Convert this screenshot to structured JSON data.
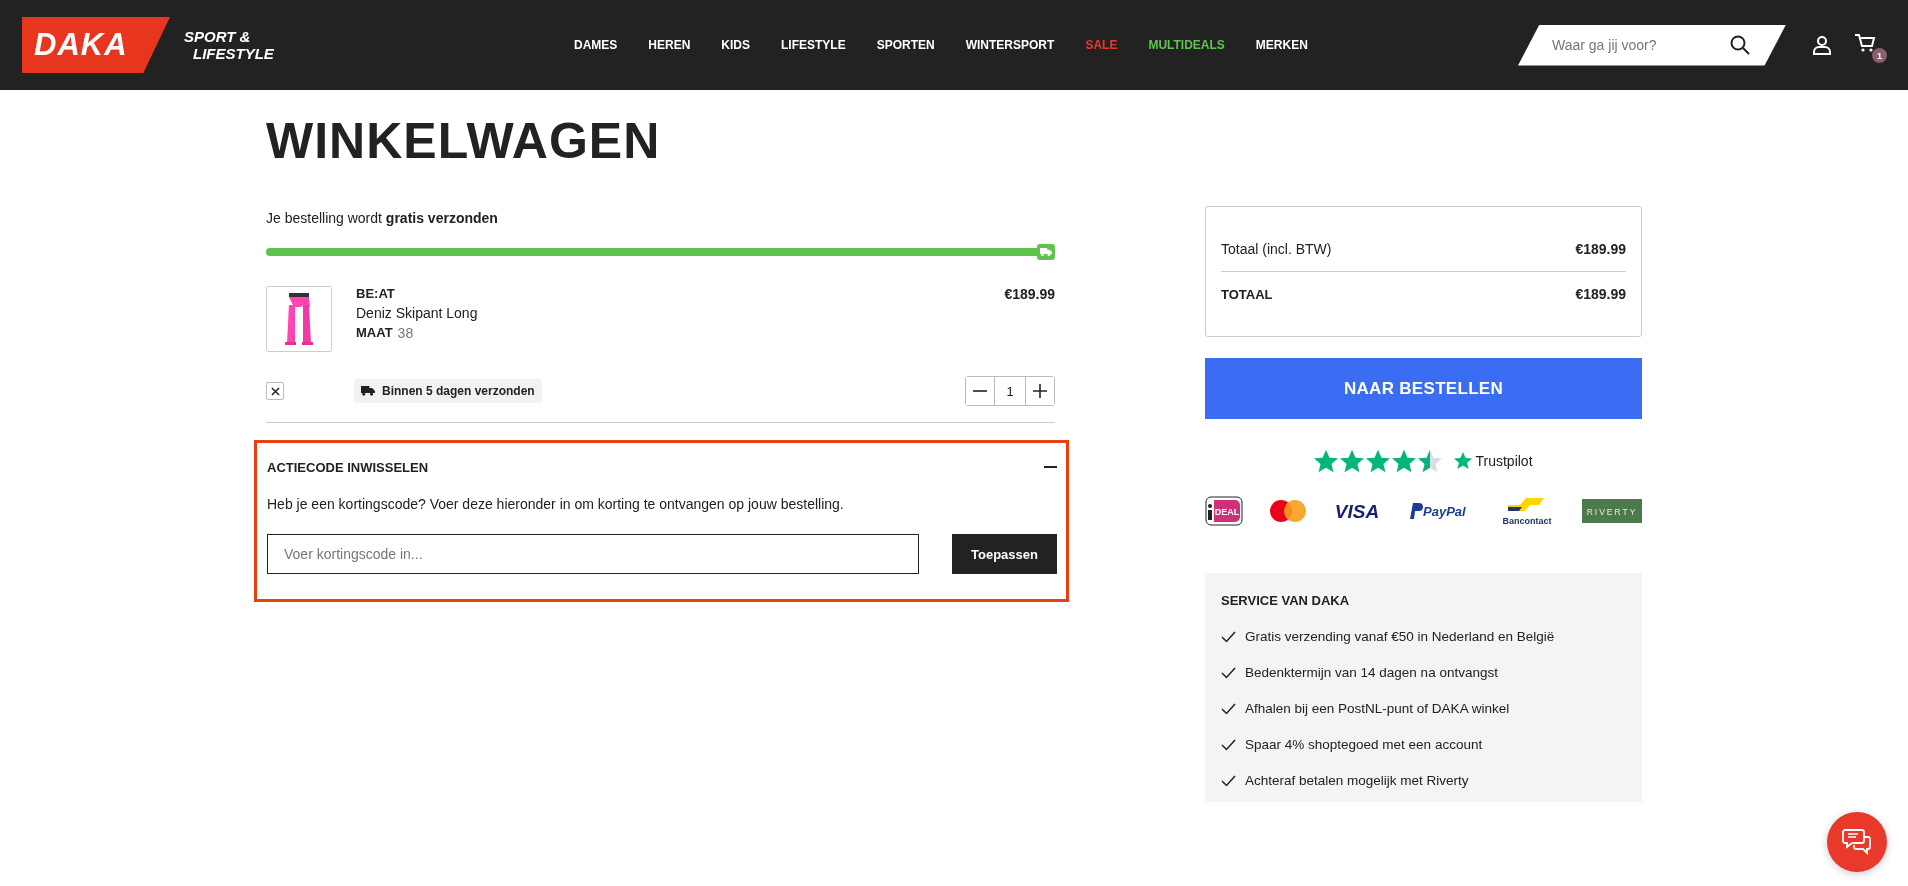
{
  "header": {
    "logo": "DAKA",
    "tagline": [
      "SPORT &",
      "LIFESTYLE"
    ],
    "nav": [
      {
        "label": "DAMES",
        "color": "#ffffff"
      },
      {
        "label": "HEREN",
        "color": "#ffffff"
      },
      {
        "label": "KIDS",
        "color": "#ffffff"
      },
      {
        "label": "LIFESTYLE",
        "color": "#ffffff"
      },
      {
        "label": "SPORTEN",
        "color": "#ffffff"
      },
      {
        "label": "WINTERSPORT",
        "color": "#ffffff"
      },
      {
        "label": "SALE",
        "color": "#e8392a"
      },
      {
        "label": "MULTIDEALS",
        "color": "#5ec44f"
      },
      {
        "label": "MERKEN",
        "color": "#ffffff"
      }
    ],
    "search": {
      "placeholder": "Waar ga jij voor?"
    },
    "cart_count": "1"
  },
  "page_title": "WINKELWAGEN",
  "shipping": {
    "message": "Je bestelling wordt **gratis verzonden**",
    "level": 1
  },
  "items": [
    {
      "brand": "BE:AT",
      "name": "Deniz Skipant Long",
      "size_label": "MAAT",
      "size": "38",
      "price": "€189.99",
      "delivery": "Binnen 5 dagen verzonden",
      "quantity": "1"
    }
  ],
  "promo": {
    "title": "ACTIECODE INWISSELEN",
    "expanded": true,
    "text": "Heb je een kortingscode? Voer deze hieronder in om korting te ontvangen op jouw bestelling.",
    "placeholder": "Voer kortingscode in...",
    "button": "Toepassen"
  },
  "summary": {
    "rows": [
      {
        "kind": "subtotal",
        "label": "Totaal (incl. BTW)",
        "value": "€189.99"
      },
      {
        "kind": "total",
        "label": "TOTAAL",
        "value": "€189.99"
      }
    ],
    "checkout": "NAAR BESTELLEN"
  },
  "trustpilot": {
    "stars": 4.5,
    "label": "Trustpilot"
  },
  "payments": [
    {
      "kind": "ideal",
      "label": "DEAL"
    },
    {
      "kind": "mastercard"
    },
    {
      "kind": "visa",
      "label": "VISA"
    },
    {
      "kind": "paypal",
      "label": "PayPal"
    },
    {
      "kind": "bancontact",
      "label": "Bancontact"
    },
    {
      "kind": "riverty",
      "label": "RIVERTY"
    }
  ],
  "service": {
    "title": "SERVICE VAN DAKA",
    "items": [
      "Gratis verzending vanaf €50 in Nederland en België",
      "Bedenktermijn van 14 dagen na ontvangst",
      "Afhalen bij een PostNL-punt of DAKA winkel",
      "Spaar 4% shoptegoed met een account",
      "Achteraf betalen mogelijk met Riverty"
    ]
  }
}
